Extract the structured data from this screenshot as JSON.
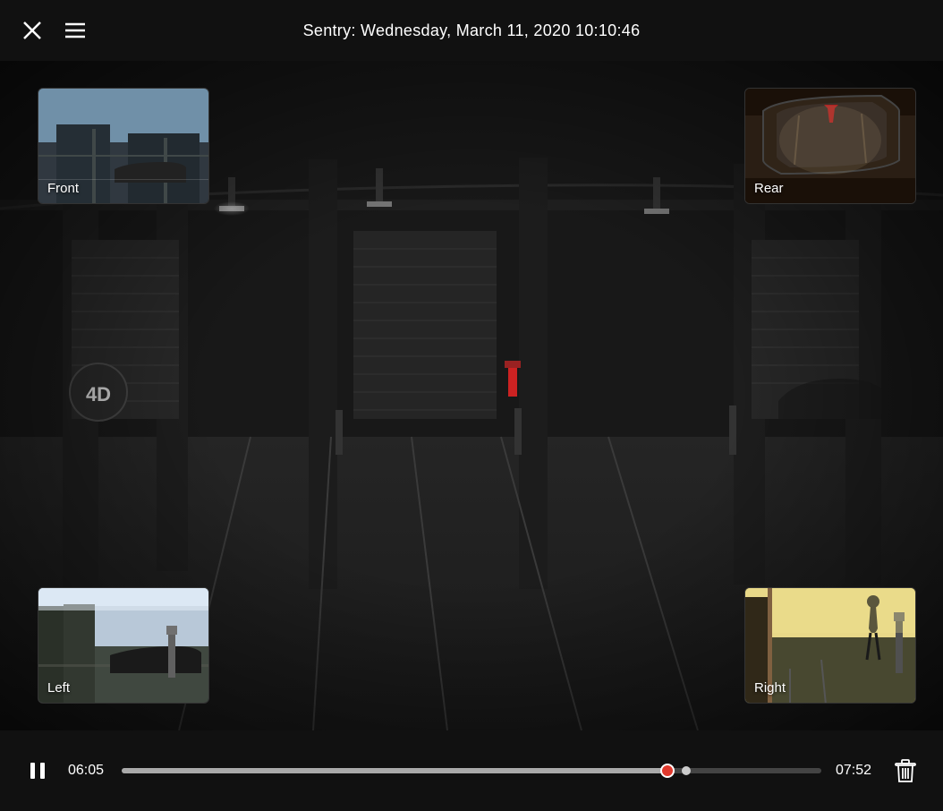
{
  "header": {
    "title": "Sentry: Wednesday, March 11, 2020 10:10:46",
    "close_label": "close",
    "menu_label": "menu"
  },
  "thumbnails": {
    "front": {
      "label": "Front"
    },
    "rear": {
      "label": "Rear"
    },
    "left": {
      "label": "Left"
    },
    "right": {
      "label": "Right"
    }
  },
  "controls": {
    "pause_label": "pause",
    "current_time": "06:05",
    "total_time": "07:52",
    "progress_percent": 78,
    "delete_label": "delete"
  },
  "colors": {
    "bg": "#111111",
    "accent": "#e0392d",
    "text": "#ffffff"
  }
}
